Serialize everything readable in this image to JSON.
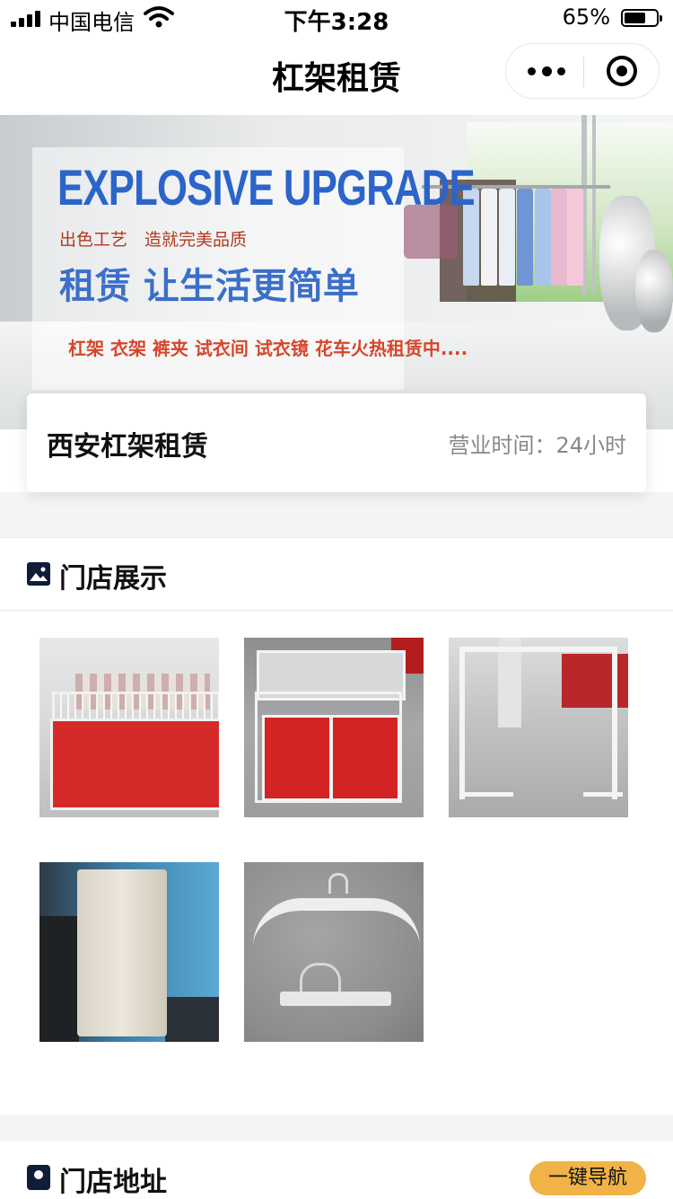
{
  "status_bar": {
    "carrier": "中国电信",
    "time": "下午3:28",
    "battery_percent": "65%",
    "battery_level": 0.65,
    "icons": [
      "signal-icon",
      "wifi-icon",
      "battery-icon"
    ]
  },
  "nav_bar": {
    "title": "杠架租赁",
    "icons": [
      "more-icon",
      "close-target-icon"
    ]
  },
  "banner": {
    "headline_en": "EXPLOSIVE UPGRADE",
    "subtitle": "出色工艺　造就完美品质",
    "slogan": "租赁 让生活更简单",
    "product_line": "杠架 衣架 裤夹 试衣间 试衣镜 花车火热租赁中...."
  },
  "store": {
    "name": "西安杠架租赁",
    "hours": "营业时间：24小时"
  },
  "gallery_section": {
    "title": "门店展示",
    "icon": "image-icon",
    "photos": [
      "red-display-counter",
      "folding-promo-cart",
      "clothing-rail",
      "fitting-room",
      "clothes-hanger"
    ]
  },
  "address_section": {
    "title": "门店地址",
    "icon": "location-pin-icon",
    "navigate_label": "一键导航"
  },
  "colors": {
    "accent": "#f1b347",
    "icon_dark": "#0f1c3a",
    "banner_blue": "#2c64c8",
    "banner_red": "#d8452b"
  }
}
